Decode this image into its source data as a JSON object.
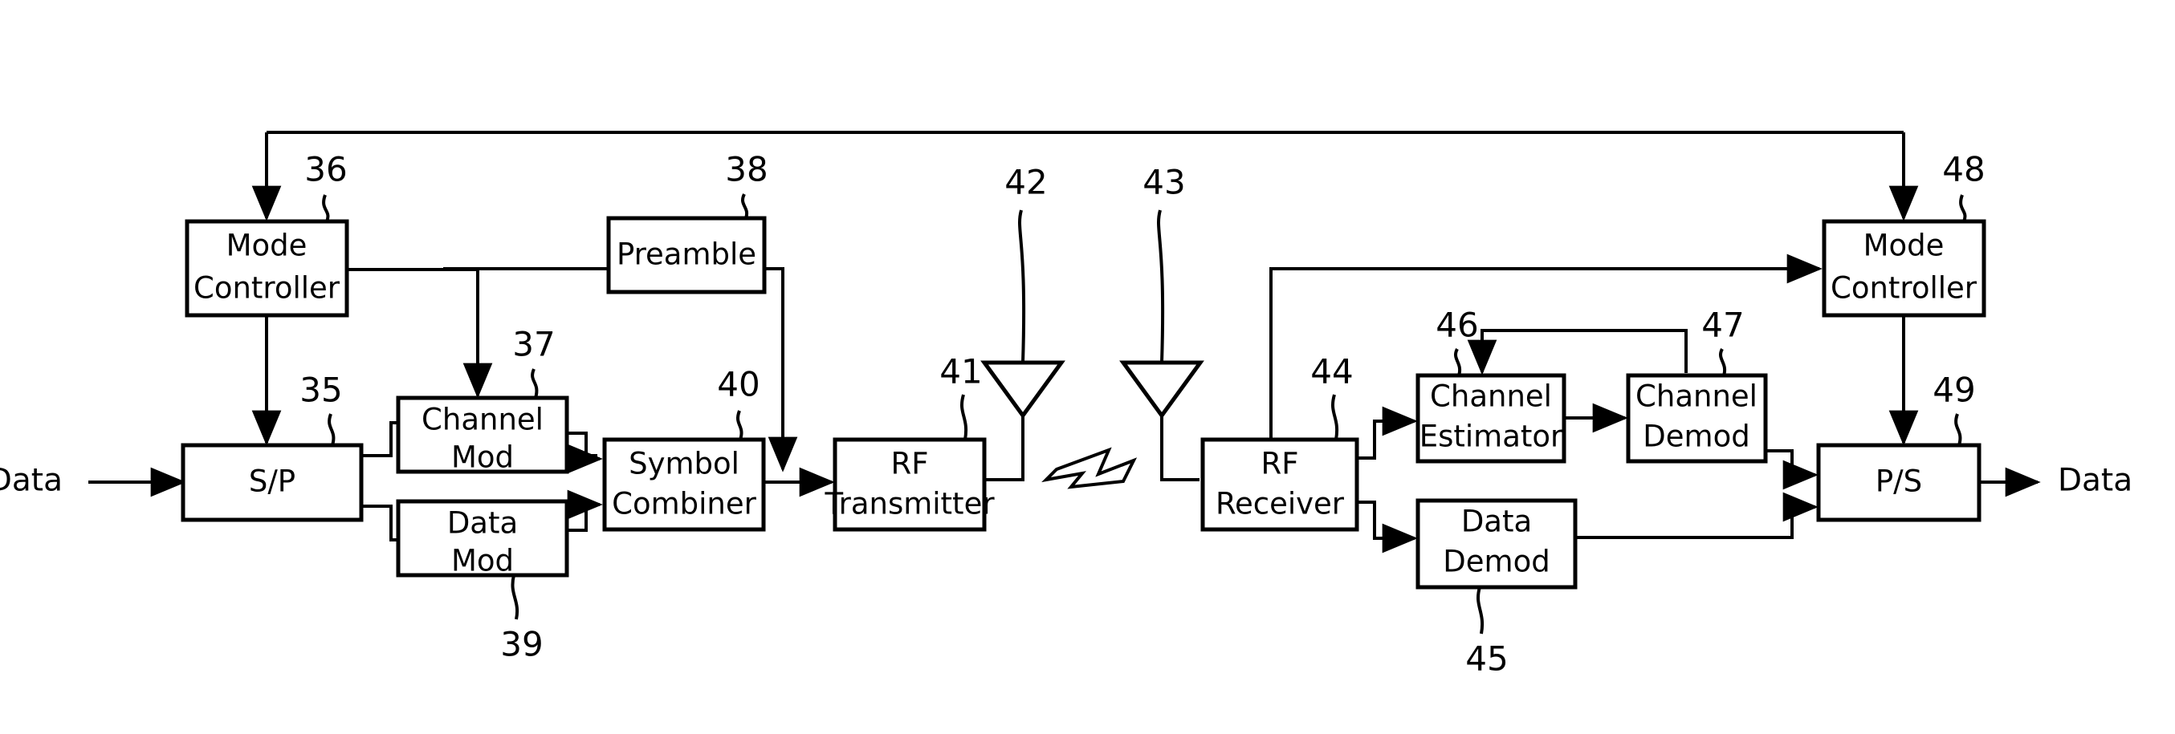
{
  "figure": {
    "type": "block-diagram",
    "domain": "patent-figure",
    "description": "OFDM transmitter and receiver chain block diagram",
    "background_color": "#ffffff",
    "line_color": "#000000"
  },
  "io_labels": {
    "input": "Data",
    "output": "Data"
  },
  "blocks": [
    {
      "id": "mode_controller_tx",
      "label_line1": "Mode",
      "label_line2": "Controller",
      "ref": "36"
    },
    {
      "id": "sp",
      "label_line1": "S/P",
      "label_line2": "",
      "ref": "35"
    },
    {
      "id": "channel_mod",
      "label_line1": "Channel",
      "label_line2": "Mod",
      "ref": "37"
    },
    {
      "id": "data_mod",
      "label_line1": "Data",
      "label_line2": "Mod",
      "ref": "39"
    },
    {
      "id": "preamble",
      "label_line1": "Preamble",
      "label_line2": "",
      "ref": "38"
    },
    {
      "id": "symbol_combiner",
      "label_line1": "Symbol",
      "label_line2": "Combiner",
      "ref": "40"
    },
    {
      "id": "rf_transmitter",
      "label_line1": "RF",
      "label_line2": "Transmitter",
      "ref": "41"
    },
    {
      "id": "antenna_tx",
      "label_line1": "",
      "label_line2": "",
      "ref": "42"
    },
    {
      "id": "antenna_rx",
      "label_line1": "",
      "label_line2": "",
      "ref": "43"
    },
    {
      "id": "rf_receiver",
      "label_line1": "RF",
      "label_line2": "Receiver",
      "ref": "44"
    },
    {
      "id": "channel_estimator",
      "label_line1": "Channel",
      "label_line2": "Estimator",
      "ref": "46"
    },
    {
      "id": "channel_demod",
      "label_line1": "Channel",
      "label_line2": "Demod",
      "ref": "47"
    },
    {
      "id": "data_demod",
      "label_line1": "Data",
      "label_line2": "Demod",
      "ref": "45"
    },
    {
      "id": "mode_controller_rx",
      "label_line1": "Mode",
      "label_line2": "Controller",
      "ref": "48"
    },
    {
      "id": "ps",
      "label_line1": "P/S",
      "label_line2": "",
      "ref": "49"
    }
  ],
  "reference_numerals": [
    "35",
    "36",
    "37",
    "38",
    "39",
    "40",
    "41",
    "42",
    "43",
    "44",
    "45",
    "46",
    "47",
    "48",
    "49"
  ]
}
